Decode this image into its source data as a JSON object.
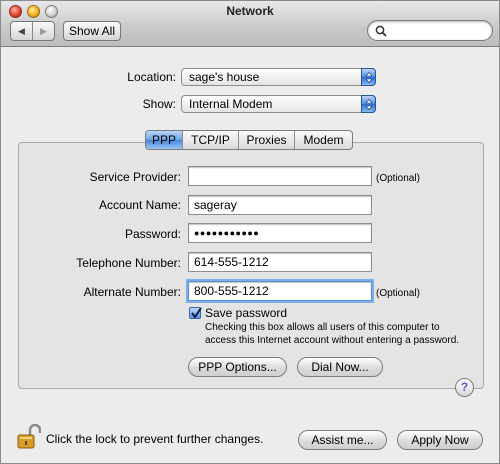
{
  "window": {
    "title": "Network"
  },
  "toolbar": {
    "back_icon": "back-arrow-icon",
    "forward_icon": "forward-arrow-icon",
    "show_all_label": "Show All",
    "search_value": ""
  },
  "location": {
    "label": "Location:",
    "value": "sage's house"
  },
  "show": {
    "label": "Show:",
    "value": "Internal Modem"
  },
  "tabs": [
    {
      "label": "PPP",
      "active": true
    },
    {
      "label": "TCP/IP",
      "active": false
    },
    {
      "label": "Proxies",
      "active": false
    },
    {
      "label": "Modem",
      "active": false
    }
  ],
  "form": {
    "service_provider": {
      "label": "Service Provider:",
      "value": "",
      "note": "(Optional)"
    },
    "account_name": {
      "label": "Account Name:",
      "value": "sageray"
    },
    "password": {
      "label": "Password:",
      "value": "●●●●●●●●●●●"
    },
    "telephone": {
      "label": "Telephone Number:",
      "value": "614-555-1212"
    },
    "alternate": {
      "label": "Alternate Number:",
      "value": "800-555-1212",
      "note": "(Optional)"
    }
  },
  "save_password": {
    "checked": true,
    "label": "Save password",
    "note_line1": "Checking this box allows all users of this computer to",
    "note_line2": "access this Internet account without entering a password."
  },
  "buttons": {
    "ppp_options": "PPP Options...",
    "dial_now": "Dial Now...",
    "help": "?",
    "assist_me": "Assist me...",
    "apply_now": "Apply Now"
  },
  "footer": {
    "lock_text": "Click the lock to prevent further changes."
  },
  "colors": {
    "accent": "#4686dc",
    "window_bg": "#ececec",
    "panel_bg": "#e4e4e4"
  }
}
